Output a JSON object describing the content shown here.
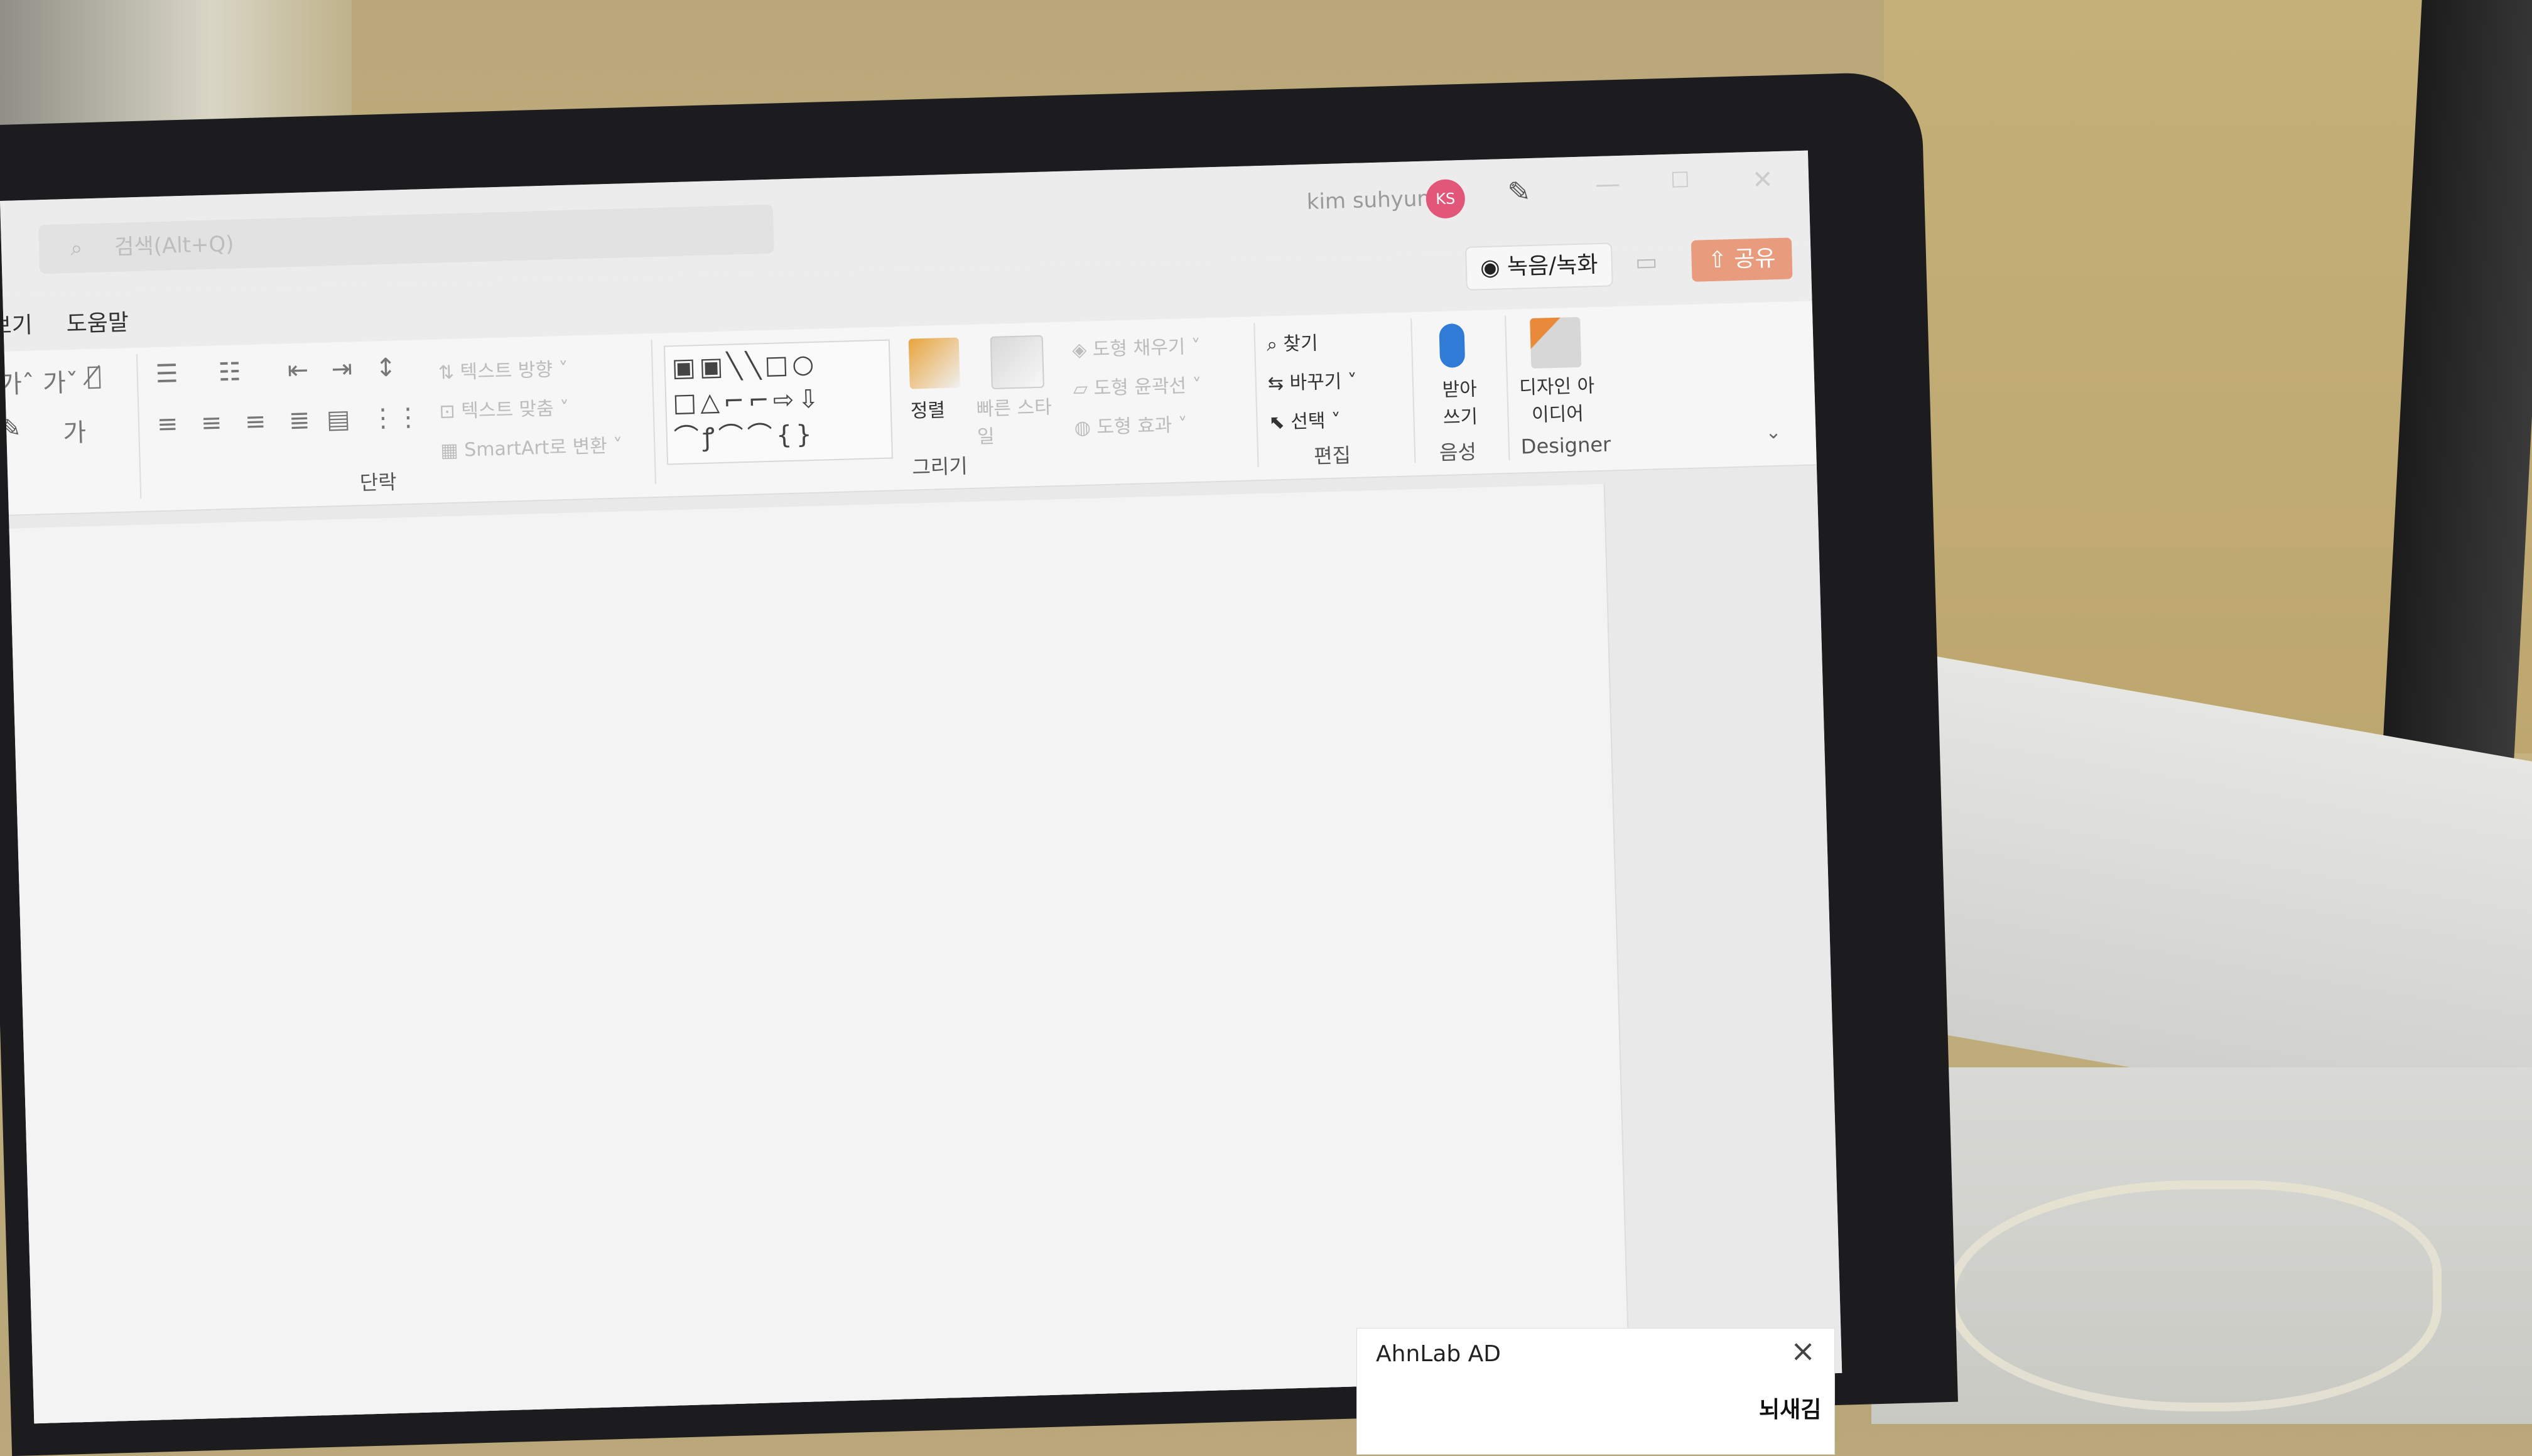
{
  "titlebar": {
    "search_placeholder": "검색(Alt+Q)",
    "user_name": "kim suhyun",
    "avatar_initials": "KS"
  },
  "tabs": {
    "view_partial": "보기",
    "help": "도움말"
  },
  "actions": {
    "record": "녹음/녹화",
    "share": "공유"
  },
  "ribbon": {
    "paragraph": {
      "label": "단락",
      "text_direction": "텍스트 방향",
      "align_text": "텍스트 맞춤",
      "smartart": "SmartArt로 변환"
    },
    "drawing": {
      "label": "그리기",
      "arrange": "정렬",
      "quick_styles": "빠른 스타일",
      "shape_fill": "도형 채우기",
      "shape_outline": "도형 윤곽선",
      "shape_effects": "도형 효과"
    },
    "editing": {
      "label": "편집",
      "find": "찾기",
      "replace": "바꾸기",
      "select": "선택"
    },
    "voice": {
      "label": "음성",
      "dictate": "받아 쓰기"
    },
    "designer": {
      "label": "Designer",
      "design_ideas": "디자인 아이디어"
    }
  },
  "ad": {
    "title": "AhnLab AD",
    "brand": "뇌새김"
  },
  "colors": {
    "share_accent": "#e89b7d",
    "avatar": "#e2567a",
    "mic": "#2f7bd6"
  }
}
